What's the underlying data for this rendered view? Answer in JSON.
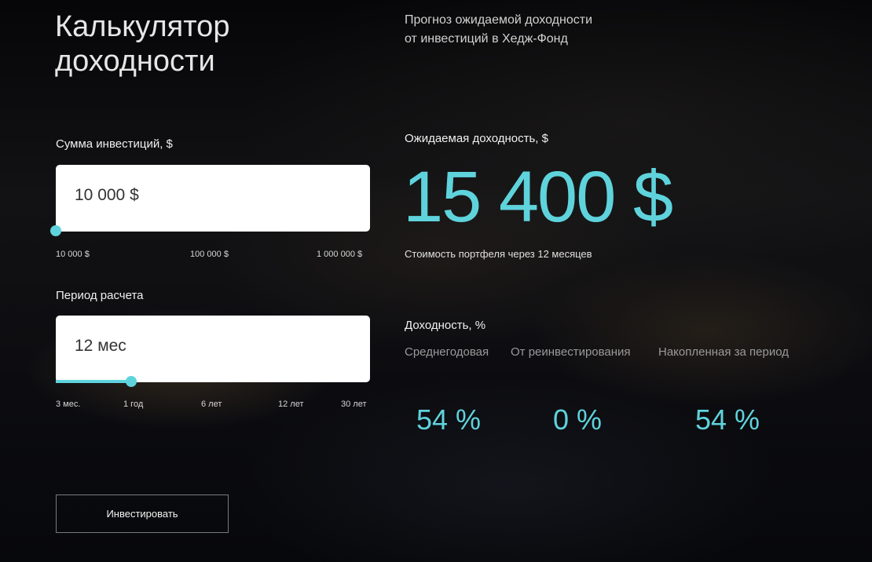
{
  "header": {
    "title": "Калькулятор\nдоходности",
    "subtitle": "Прогноз ожидаемой доходности\nот инвестиций в Хедж-Фонд"
  },
  "investment": {
    "label": "Сумма инвестиций, $",
    "value": "10 000 $",
    "slider_fraction": 0,
    "ticks": [
      "10 000 $",
      "100 000 $",
      "1 000 000 $"
    ]
  },
  "period": {
    "label": "Период расчета",
    "value": "12 мес",
    "slider_fraction": 0.24,
    "ticks": [
      "3 мес.",
      "1 год",
      "6 лет",
      "12 лет",
      "30 лет"
    ]
  },
  "expected": {
    "label": "Ожидаемая доходность, $",
    "value": "15 400 $",
    "note": "Стоимость портфеля через 12 месяцев"
  },
  "yield": {
    "label": "Доходность, %",
    "columns": [
      {
        "header": "Среднегодовая",
        "value": "54 %"
      },
      {
        "header": "От реинвестирования",
        "value": "0 %"
      },
      {
        "header": "Накопленная за период",
        "value": "54 %"
      }
    ]
  },
  "actions": {
    "invest_label": "Инвестировать"
  },
  "colors": {
    "accent": "#5fd3dc",
    "background": "#0b0b0e"
  }
}
